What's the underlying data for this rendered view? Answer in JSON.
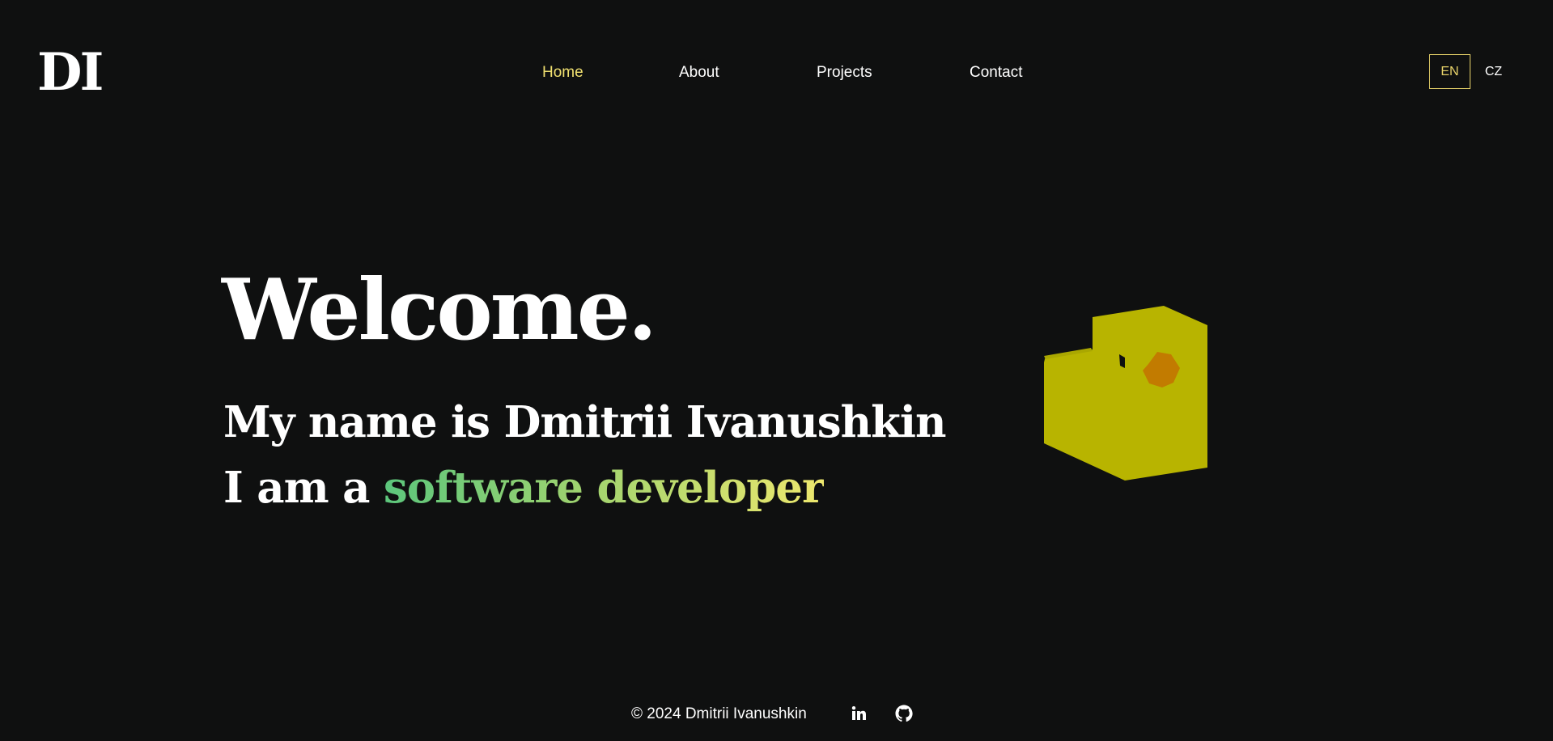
{
  "header": {
    "logo": "DI",
    "nav": [
      {
        "label": "Home",
        "active": true
      },
      {
        "label": "About",
        "active": false
      },
      {
        "label": "Projects",
        "active": false
      },
      {
        "label": "Contact",
        "active": false
      }
    ],
    "languages": [
      {
        "label": "EN",
        "selected": true
      },
      {
        "label": "CZ",
        "selected": false
      }
    ]
  },
  "hero": {
    "heading": "Welcome.",
    "name_line": "My name is Dmitrii Ivanushkin",
    "role_prefix": "I am a ",
    "role_highlight": "software developer",
    "illustration": "rubber-duck"
  },
  "footer": {
    "copyright": "© 2024 Dmitrii Ivanushkin",
    "social_icons": [
      "linkedin-icon",
      "github-icon"
    ]
  },
  "colors": {
    "background": "#0f1010",
    "text": "#ffffff",
    "accent": "#f0e070",
    "gradient_start": "#5cc67c",
    "gradient_end": "#eee86e",
    "duck_body": "#b8b400",
    "duck_beak": "#c27b00"
  }
}
